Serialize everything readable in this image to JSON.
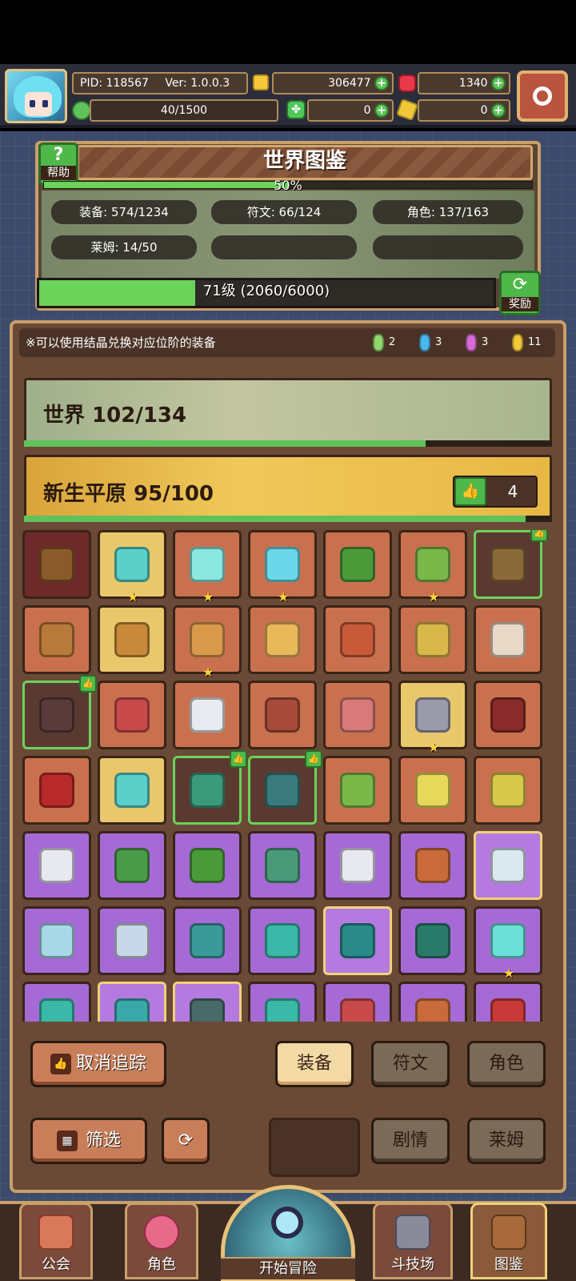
{
  "hud": {
    "pid": "PID: 118567",
    "version": "Ver: 1.0.0.3",
    "stamina": "40/1500",
    "gold": "306477",
    "gems": "1340",
    "clover": "0",
    "key": "0"
  },
  "header": {
    "title": "世界图鉴",
    "help_label": "帮助",
    "progress_text": "50%",
    "progress_value": 0.5,
    "stats": {
      "equipment": "装备: 574/1234",
      "runes": "符文: 66/124",
      "characters": "角色: 137/163",
      "slimes": "莱姆: 14/50"
    },
    "level_text": "71级 (2060/6000)",
    "level_value": 0.343,
    "reward_label": "奖励"
  },
  "note": {
    "text": "※可以使用结晶兑换对应位阶的装备",
    "crystals": [
      {
        "color": "#8fd86a",
        "count": "2"
      },
      {
        "color": "#4ab8f0",
        "count": "3"
      },
      {
        "color": "#d86ad8",
        "count": "3"
      },
      {
        "color": "#f0c83a",
        "count": "11"
      }
    ]
  },
  "world": {
    "label": "世界 102/134",
    "progress_value": 0.761
  },
  "zone": {
    "label": "新生平原 95/100",
    "progress_value": 0.95,
    "track_count": "4"
  },
  "grid": {
    "rows": [
      [
        {
          "bg": "dark",
          "item": "#8a5a2a"
        },
        {
          "bg": "gold",
          "item": "#5ad0c8",
          "star": true
        },
        {
          "bg": "brown",
          "item": "#8ae8e0",
          "star": true
        },
        {
          "bg": "brown",
          "item": "#6ad8e8",
          "star": true
        },
        {
          "bg": "brown",
          "item": "#4a9a3a"
        },
        {
          "bg": "brown",
          "item": "#7ab84a",
          "star": true
        },
        {
          "bg": "darkg",
          "item": "#8a6a3a",
          "thumb": true
        }
      ],
      [
        {
          "bg": "brown",
          "item": "#b87a3a"
        },
        {
          "bg": "gold",
          "item": "#c88a3a"
        },
        {
          "bg": "brown",
          "item": "#d89a4a",
          "star": true
        },
        {
          "bg": "brown",
          "item": "#e8b85a"
        },
        {
          "bg": "brown",
          "item": "#c85a3a"
        },
        {
          "bg": "brown",
          "item": "#d8b84a"
        },
        {
          "bg": "brown",
          "item": "#e8d8c8"
        }
      ],
      [
        {
          "bg": "darkg",
          "item": "#5a3a3a",
          "thumb": true
        },
        {
          "bg": "brown",
          "item": "#c84a4a"
        },
        {
          "bg": "brown",
          "item": "#e8eaf0"
        },
        {
          "bg": "brown",
          "item": "#a84a3a"
        },
        {
          "bg": "brown",
          "item": "#d87a7a"
        },
        {
          "bg": "gold",
          "item": "#9a9aaa",
          "star": true
        },
        {
          "bg": "brown",
          "item": "#8a2a2a"
        }
      ],
      [
        {
          "bg": "brown",
          "item": "#b82a2a"
        },
        {
          "bg": "gold",
          "item": "#5ad0c8"
        },
        {
          "bg": "darkg",
          "item": "#3a9a7a",
          "thumb": true
        },
        {
          "bg": "darkg",
          "item": "#3a7a7a",
          "thumb": true
        },
        {
          "bg": "brown",
          "item": "#7ab84a"
        },
        {
          "bg": "brown",
          "item": "#e8d85a"
        },
        {
          "bg": "brown",
          "item": "#d8c84a"
        }
      ],
      [
        {
          "bg": "purple",
          "item": "#e8e8f0"
        },
        {
          "bg": "purple",
          "item": "#4a9a4a"
        },
        {
          "bg": "purple",
          "item": "#4a9a3a"
        },
        {
          "bg": "purple",
          "item": "#4a9a7a"
        },
        {
          "bg": "purple",
          "item": "#e8e8f0"
        },
        {
          "bg": "purple",
          "item": "#c86a3a"
        },
        {
          "bg": "purpleg",
          "item": "#dae8f0"
        }
      ],
      [
        {
          "bg": "purple",
          "item": "#a8d8e8"
        },
        {
          "bg": "purple",
          "item": "#c8d8e8"
        },
        {
          "bg": "purple",
          "item": "#3a9a9a"
        },
        {
          "bg": "purple",
          "item": "#3ab8a8"
        },
        {
          "bg": "purpleg",
          "item": "#2a8a8a"
        },
        {
          "bg": "purple",
          "item": "#2a7a6a"
        },
        {
          "bg": "purple",
          "item": "#6ae0d8",
          "star": true
        }
      ],
      [
        {
          "bg": "purple",
          "item": "#3ab8a8"
        },
        {
          "bg": "purpleg",
          "item": "#3aa8a8"
        },
        {
          "bg": "purpleg",
          "item": "#4a6a6a"
        },
        {
          "bg": "purple",
          "item": "#3ab8a8"
        },
        {
          "bg": "purple",
          "item": "#c84a4a"
        },
        {
          "bg": "purple",
          "item": "#c86a3a"
        },
        {
          "bg": "purple",
          "item": "#c83a3a"
        }
      ]
    ]
  },
  "controls": {
    "untrack": "取消追踪",
    "filter": "筛选",
    "tab_equipment": "装备",
    "tab_runes": "符文",
    "tab_characters": "角色",
    "tab_story": "剧情",
    "tab_slimes": "莱姆"
  },
  "nav": {
    "guild": "公会",
    "character": "角色",
    "adventure": "开始冒险",
    "arena": "斗技场",
    "codex": "图鉴"
  },
  "colors": {
    "accent_green": "#5fc25a",
    "panel_border": "#c9a06a"
  }
}
